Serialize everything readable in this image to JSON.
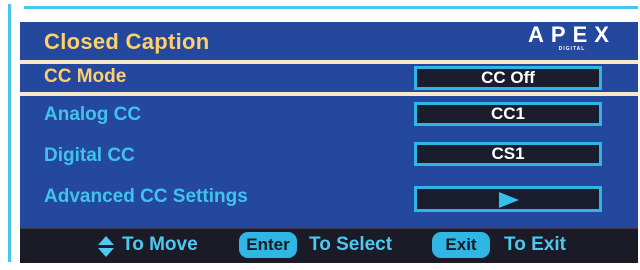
{
  "header": {
    "title": "Closed Caption",
    "logo_text": "APEX",
    "logo_subtext": "DIGITAL"
  },
  "menu": {
    "items": [
      {
        "label": "CC Mode",
        "value": "CC Off",
        "selected": true
      },
      {
        "label": "Analog CC",
        "value": "CC1",
        "selected": false
      },
      {
        "label": "Digital CC",
        "value": "CS1",
        "selected": false
      },
      {
        "label": "Advanced CC Settings",
        "value": "",
        "icon": "play-arrow-icon",
        "selected": false
      }
    ]
  },
  "footer": {
    "move_text": "To Move",
    "enter_key": "Enter",
    "select_text": "To Select",
    "exit_key": "Exit",
    "exit_text": "To Exit"
  },
  "colors": {
    "panel_bg": "#24489d",
    "title": "#ffcf6a",
    "selected_label": "#ffcf6a",
    "label": "#3fc3ee",
    "accent": "#30b6e4",
    "value_bg": "#1a1d2e",
    "footer_bg": "#1a1b26"
  }
}
